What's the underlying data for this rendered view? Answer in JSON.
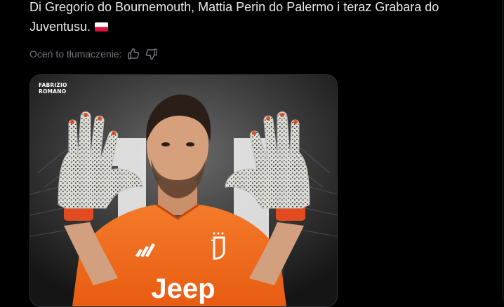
{
  "tweet": {
    "text_line1": "Di Gregorio do Bournemouth, Mattia Perin do Palermo i teraz Grabara do",
    "text_line2": "Juventusu.",
    "flag_icon": "poland-flag-icon"
  },
  "translation": {
    "label": "Oceń to tłumaczenie:",
    "thumbs_up_icon": "thumbs-up-icon",
    "thumbs_down_icon": "thumbs-down-icon"
  },
  "media": {
    "watermark_line1": "FABRIZIO",
    "watermark_line2": "ROMANO",
    "shirt_sponsor": "Jeep",
    "shirt_color": "#f26a1b",
    "glove_color": "#d8d8d2"
  }
}
